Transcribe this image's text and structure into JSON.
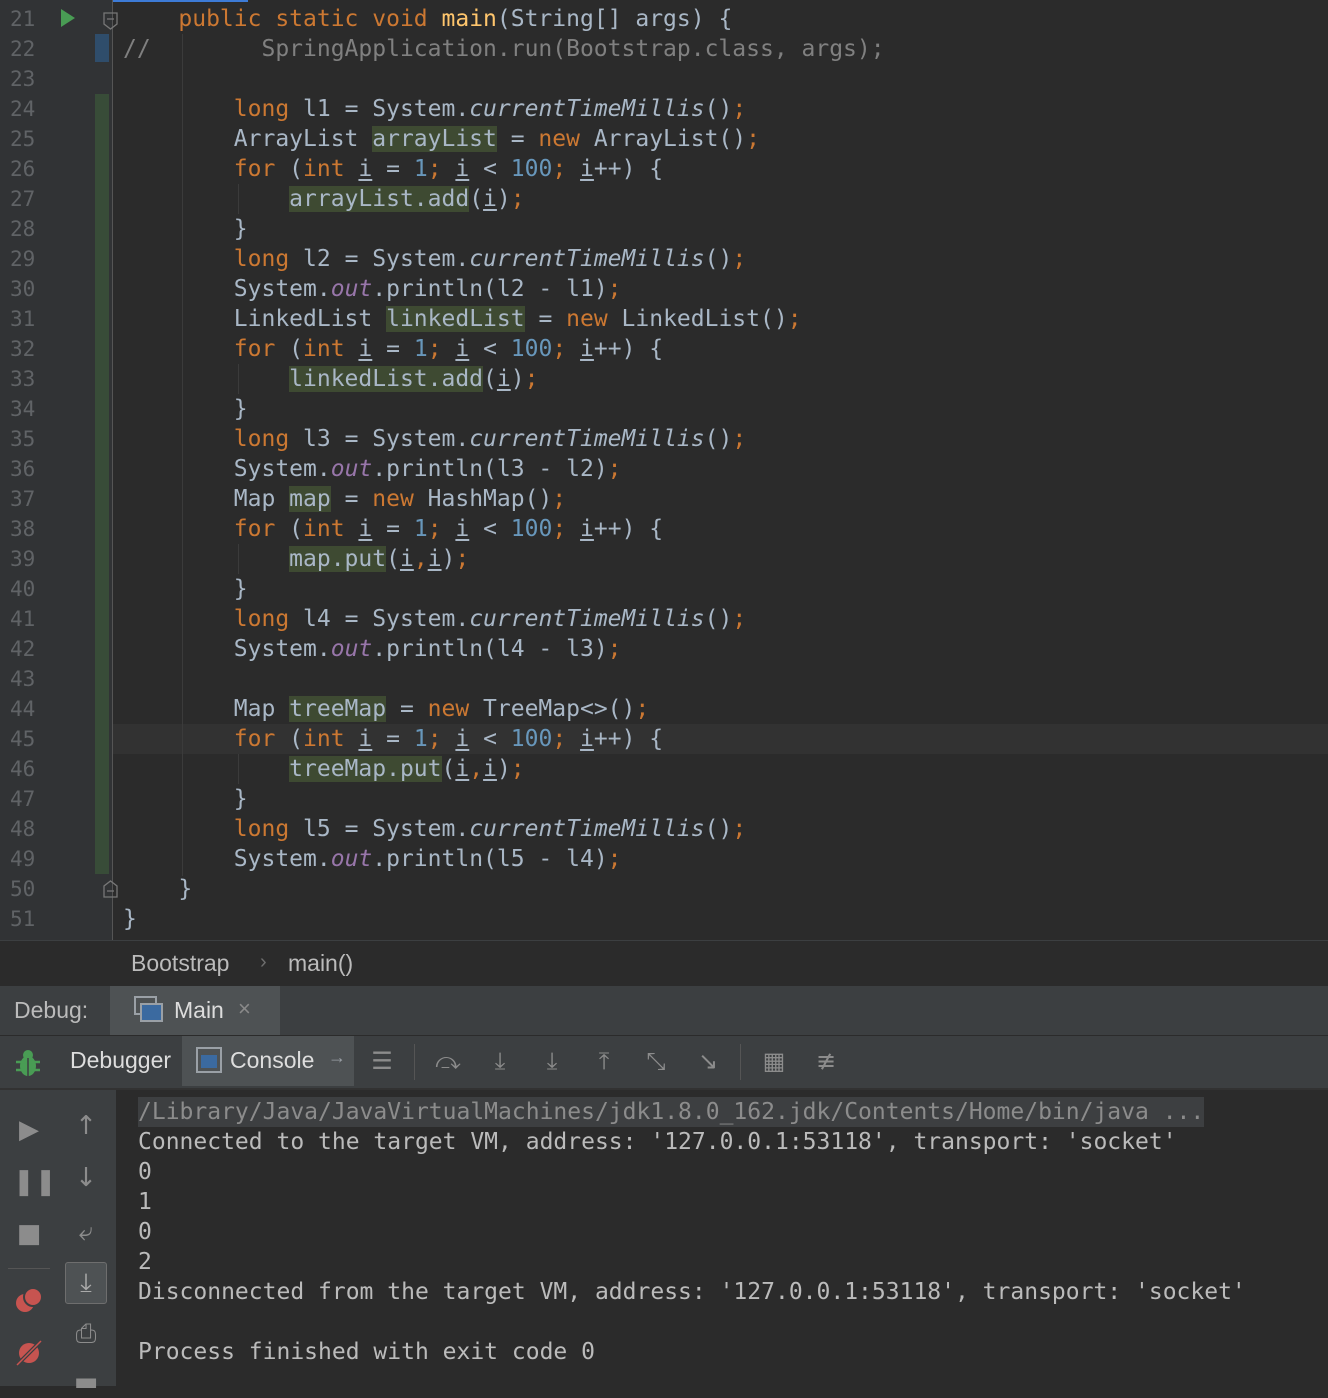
{
  "editor": {
    "line_numbers": [
      "21",
      "22",
      "23",
      "24",
      "25",
      "26",
      "27",
      "28",
      "29",
      "30",
      "31",
      "32",
      "33",
      "34",
      "35",
      "36",
      "37",
      "38",
      "39",
      "40",
      "41",
      "42",
      "43",
      "44",
      "45",
      "46",
      "47",
      "48",
      "49",
      "50",
      "51"
    ],
    "lines": [
      [
        {
          "t": "    ",
          "c": ""
        },
        {
          "t": "public static void ",
          "c": "kw"
        },
        {
          "t": "main",
          "c": "fn"
        },
        {
          "t": "(String[] args) {",
          "c": ""
        }
      ],
      [
        {
          "t": "//        SpringApplication.run(Bootstrap.class, args);",
          "c": "cm"
        }
      ],
      [],
      [
        {
          "t": "        ",
          "c": ""
        },
        {
          "t": "long ",
          "c": "kw"
        },
        {
          "t": "l1 = System.",
          "c": ""
        },
        {
          "t": "currentTimeMillis",
          "c": "it"
        },
        {
          "t": "()",
          "c": ""
        },
        {
          "t": ";",
          "c": "kw"
        }
      ],
      [
        {
          "t": "        ArrayList ",
          "c": ""
        },
        {
          "t": "arrayList",
          "c": "hl"
        },
        {
          "t": " = ",
          "c": ""
        },
        {
          "t": "new ",
          "c": "kw"
        },
        {
          "t": "ArrayList()",
          "c": ""
        },
        {
          "t": ";",
          "c": "kw"
        }
      ],
      [
        {
          "t": "        ",
          "c": ""
        },
        {
          "t": "for ",
          "c": "kw"
        },
        {
          "t": "(",
          "c": ""
        },
        {
          "t": "int ",
          "c": "kw"
        },
        {
          "t": "i",
          "c": "ul"
        },
        {
          "t": " = ",
          "c": ""
        },
        {
          "t": "1",
          "c": "num"
        },
        {
          "t": "; ",
          "c": "kw"
        },
        {
          "t": "i",
          "c": "ul"
        },
        {
          "t": " < ",
          "c": ""
        },
        {
          "t": "100",
          "c": "num"
        },
        {
          "t": "; ",
          "c": "kw"
        },
        {
          "t": "i",
          "c": "ul"
        },
        {
          "t": "++) {",
          "c": ""
        }
      ],
      [
        {
          "t": "            ",
          "c": ""
        },
        {
          "t": "arrayList.add",
          "c": "hl"
        },
        {
          "t": "(",
          "c": ""
        },
        {
          "t": "i",
          "c": "ul"
        },
        {
          "t": ")",
          "c": ""
        },
        {
          "t": ";",
          "c": "kw"
        }
      ],
      [
        {
          "t": "        }",
          "c": ""
        }
      ],
      [
        {
          "t": "        ",
          "c": ""
        },
        {
          "t": "long ",
          "c": "kw"
        },
        {
          "t": "l2 = System.",
          "c": ""
        },
        {
          "t": "currentTimeMillis",
          "c": "it"
        },
        {
          "t": "()",
          "c": ""
        },
        {
          "t": ";",
          "c": "kw"
        }
      ],
      [
        {
          "t": "        System.",
          "c": ""
        },
        {
          "t": "out",
          "c": "st"
        },
        {
          "t": ".println(l2 - l1)",
          "c": ""
        },
        {
          "t": ";",
          "c": "kw"
        }
      ],
      [
        {
          "t": "        LinkedList ",
          "c": ""
        },
        {
          "t": "linkedList",
          "c": "hl"
        },
        {
          "t": " = ",
          "c": ""
        },
        {
          "t": "new ",
          "c": "kw"
        },
        {
          "t": "LinkedList()",
          "c": ""
        },
        {
          "t": ";",
          "c": "kw"
        }
      ],
      [
        {
          "t": "        ",
          "c": ""
        },
        {
          "t": "for ",
          "c": "kw"
        },
        {
          "t": "(",
          "c": ""
        },
        {
          "t": "int ",
          "c": "kw"
        },
        {
          "t": "i",
          "c": "ul"
        },
        {
          "t": " = ",
          "c": ""
        },
        {
          "t": "1",
          "c": "num"
        },
        {
          "t": "; ",
          "c": "kw"
        },
        {
          "t": "i",
          "c": "ul"
        },
        {
          "t": " < ",
          "c": ""
        },
        {
          "t": "100",
          "c": "num"
        },
        {
          "t": "; ",
          "c": "kw"
        },
        {
          "t": "i",
          "c": "ul"
        },
        {
          "t": "++) {",
          "c": ""
        }
      ],
      [
        {
          "t": "            ",
          "c": ""
        },
        {
          "t": "linkedList.add",
          "c": "hl"
        },
        {
          "t": "(",
          "c": ""
        },
        {
          "t": "i",
          "c": "ul"
        },
        {
          "t": ")",
          "c": ""
        },
        {
          "t": ";",
          "c": "kw"
        }
      ],
      [
        {
          "t": "        }",
          "c": ""
        }
      ],
      [
        {
          "t": "        ",
          "c": ""
        },
        {
          "t": "long ",
          "c": "kw"
        },
        {
          "t": "l3 = System.",
          "c": ""
        },
        {
          "t": "currentTimeMillis",
          "c": "it"
        },
        {
          "t": "()",
          "c": ""
        },
        {
          "t": ";",
          "c": "kw"
        }
      ],
      [
        {
          "t": "        System.",
          "c": ""
        },
        {
          "t": "out",
          "c": "st"
        },
        {
          "t": ".println(l3 - l2)",
          "c": ""
        },
        {
          "t": ";",
          "c": "kw"
        }
      ],
      [
        {
          "t": "        Map ",
          "c": ""
        },
        {
          "t": "map",
          "c": "hl"
        },
        {
          "t": " = ",
          "c": ""
        },
        {
          "t": "new ",
          "c": "kw"
        },
        {
          "t": "HashMap()",
          "c": ""
        },
        {
          "t": ";",
          "c": "kw"
        }
      ],
      [
        {
          "t": "        ",
          "c": ""
        },
        {
          "t": "for ",
          "c": "kw"
        },
        {
          "t": "(",
          "c": ""
        },
        {
          "t": "int ",
          "c": "kw"
        },
        {
          "t": "i",
          "c": "ul"
        },
        {
          "t": " = ",
          "c": ""
        },
        {
          "t": "1",
          "c": "num"
        },
        {
          "t": "; ",
          "c": "kw"
        },
        {
          "t": "i",
          "c": "ul"
        },
        {
          "t": " < ",
          "c": ""
        },
        {
          "t": "100",
          "c": "num"
        },
        {
          "t": "; ",
          "c": "kw"
        },
        {
          "t": "i",
          "c": "ul"
        },
        {
          "t": "++) {",
          "c": ""
        }
      ],
      [
        {
          "t": "            ",
          "c": ""
        },
        {
          "t": "map.put",
          "c": "hl"
        },
        {
          "t": "(",
          "c": ""
        },
        {
          "t": "i",
          "c": "ul"
        },
        {
          "t": ",",
          "c": "kw"
        },
        {
          "t": "i",
          "c": "ul"
        },
        {
          "t": ")",
          "c": ""
        },
        {
          "t": ";",
          "c": "kw"
        }
      ],
      [
        {
          "t": "        }",
          "c": ""
        }
      ],
      [
        {
          "t": "        ",
          "c": ""
        },
        {
          "t": "long ",
          "c": "kw"
        },
        {
          "t": "l4 = System.",
          "c": ""
        },
        {
          "t": "currentTimeMillis",
          "c": "it"
        },
        {
          "t": "()",
          "c": ""
        },
        {
          "t": ";",
          "c": "kw"
        }
      ],
      [
        {
          "t": "        System.",
          "c": ""
        },
        {
          "t": "out",
          "c": "st"
        },
        {
          "t": ".println(l4 - l3)",
          "c": ""
        },
        {
          "t": ";",
          "c": "kw"
        }
      ],
      [],
      [
        {
          "t": "        Map ",
          "c": ""
        },
        {
          "t": "treeMap",
          "c": "hl"
        },
        {
          "t": " = ",
          "c": ""
        },
        {
          "t": "new ",
          "c": "kw"
        },
        {
          "t": "TreeMap<>()",
          "c": ""
        },
        {
          "t": ";",
          "c": "kw"
        }
      ],
      [
        {
          "t": "        ",
          "c": ""
        },
        {
          "t": "for ",
          "c": "kw"
        },
        {
          "t": "(",
          "c": ""
        },
        {
          "t": "int ",
          "c": "kw"
        },
        {
          "t": "i",
          "c": "ul"
        },
        {
          "t": " = ",
          "c": ""
        },
        {
          "t": "1",
          "c": "num"
        },
        {
          "t": "; ",
          "c": "kw"
        },
        {
          "t": "i",
          "c": "ul"
        },
        {
          "t": " < ",
          "c": ""
        },
        {
          "t": "100",
          "c": "num"
        },
        {
          "t": "; ",
          "c": "kw"
        },
        {
          "t": "i",
          "c": "ul"
        },
        {
          "t": "++) {",
          "c": ""
        }
      ],
      [
        {
          "t": "            ",
          "c": ""
        },
        {
          "t": "treeMap.put",
          "c": "hl"
        },
        {
          "t": "(",
          "c": ""
        },
        {
          "t": "i",
          "c": "ul"
        },
        {
          "t": ",",
          "c": "kw"
        },
        {
          "t": "i",
          "c": "ul"
        },
        {
          "t": ")",
          "c": ""
        },
        {
          "t": ";",
          "c": "kw"
        }
      ],
      [
        {
          "t": "        }",
          "c": ""
        }
      ],
      [
        {
          "t": "        ",
          "c": ""
        },
        {
          "t": "long ",
          "c": "kw"
        },
        {
          "t": "l5 = System.",
          "c": ""
        },
        {
          "t": "currentTimeMillis",
          "c": "it"
        },
        {
          "t": "()",
          "c": ""
        },
        {
          "t": ";",
          "c": "kw"
        }
      ],
      [
        {
          "t": "        System.",
          "c": ""
        },
        {
          "t": "out",
          "c": "st"
        },
        {
          "t": ".println(l5 - l4)",
          "c": ""
        },
        {
          "t": ";",
          "c": "kw"
        }
      ],
      [
        {
          "t": "    }",
          "c": ""
        }
      ],
      [
        {
          "t": "}",
          "c": ""
        }
      ]
    ]
  },
  "breadcrumb": {
    "class_name": "Bootstrap",
    "separator": "›",
    "method": "main()"
  },
  "debug": {
    "label": "Debug:",
    "session_tab": "Main",
    "close_symbol": "×",
    "tab_debugger": "Debugger",
    "tab_console": "Console",
    "console_arrow": "→"
  },
  "console": {
    "lines": [
      "/Library/Java/JavaVirtualMachines/jdk1.8.0_162.jdk/Contents/Home/bin/java ...",
      "Connected to the target VM, address: '127.0.0.1:53118', transport: 'socket'",
      "0",
      "1",
      "0",
      "2",
      "Disconnected from the target VM, address: '127.0.0.1:53118', transport: 'socket'",
      "",
      "Process finished with exit code 0"
    ]
  },
  "colors": {
    "background": "#2b2b2b",
    "keyword": "#cc7832",
    "number": "#6897bb",
    "method": "#ffc66d",
    "static_field": "#9876aa",
    "comment": "#808080"
  },
  "icons": [
    "run-icon",
    "fold-icon",
    "bug-icon",
    "console-icon",
    "resume-icon",
    "pause-icon",
    "stop-icon",
    "breakpoints-icon",
    "mute-breakpoints-icon",
    "up-icon",
    "down-icon",
    "soft-wrap-icon",
    "scroll-end-icon",
    "print-icon",
    "clear-icon",
    "step-over-icon",
    "step-into-icon",
    "force-step-into-icon",
    "step-out-icon",
    "drop-frame-icon",
    "run-to-cursor-icon",
    "evaluate-icon",
    "trace-icon"
  ]
}
